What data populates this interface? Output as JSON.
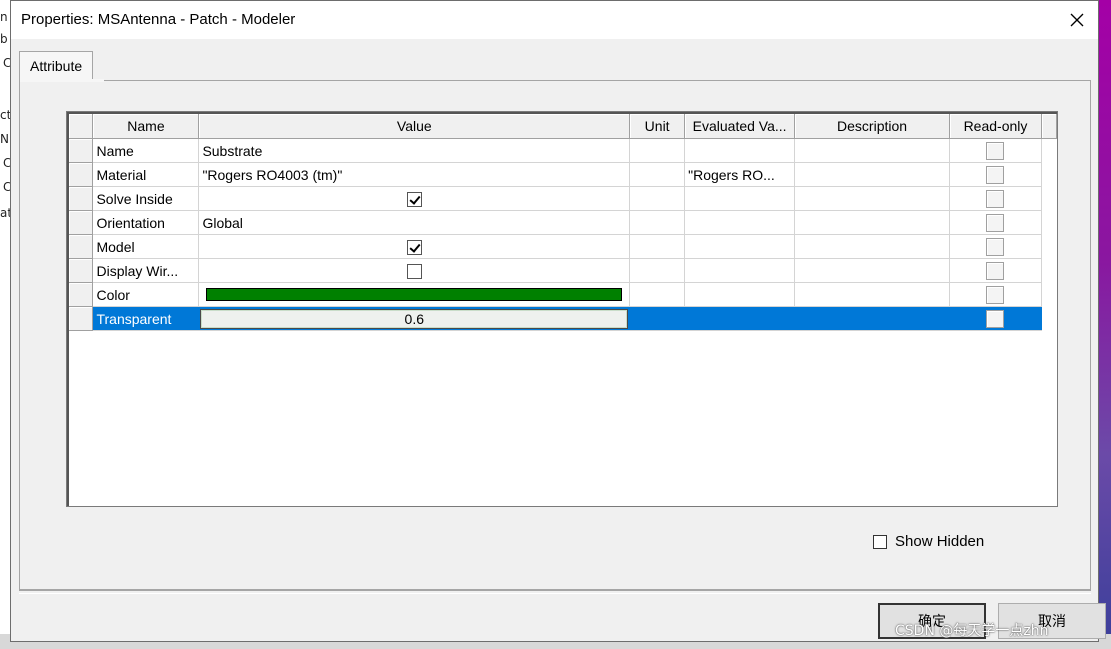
{
  "window": {
    "title": "Properties: MSAntenna - Patch - Modeler"
  },
  "tabs": [
    {
      "label": "Attribute",
      "active": true
    }
  ],
  "grid": {
    "columns": [
      "Name",
      "Value",
      "Unit",
      "Evaluated Va...",
      "Description",
      "Read-only"
    ],
    "rows": [
      {
        "name": "Name",
        "value": "Substrate",
        "value_type": "text",
        "unit": "",
        "evaluated": "",
        "description": "",
        "read_only": false
      },
      {
        "name": "Material",
        "value": "\"Rogers RO4003 (tm)\"",
        "value_type": "text",
        "unit": "",
        "evaluated": "\"Rogers RO...",
        "description": "",
        "read_only": false
      },
      {
        "name": "Solve Inside",
        "value_type": "checkbox",
        "checked": true,
        "unit": "",
        "evaluated": "",
        "description": "",
        "read_only": false
      },
      {
        "name": "Orientation",
        "value": "Global",
        "value_type": "text",
        "unit": "",
        "evaluated": "",
        "description": "",
        "read_only": false
      },
      {
        "name": "Model",
        "value_type": "checkbox",
        "checked": true,
        "unit": "",
        "evaluated": "",
        "description": "",
        "read_only": false
      },
      {
        "name": "Display Wir...",
        "value_type": "checkbox",
        "checked": false,
        "unit": "",
        "evaluated": "",
        "description": "",
        "read_only": false
      },
      {
        "name": "Color",
        "value_type": "color",
        "color": "#008000",
        "unit": "",
        "evaluated": "",
        "description": "",
        "read_only": false
      },
      {
        "name": "Transparent",
        "value": "0.6",
        "value_type": "edit",
        "unit": "",
        "evaluated": "",
        "description": "",
        "read_only": false,
        "selected": true
      }
    ]
  },
  "options": {
    "show_hidden_label": "Show Hidden",
    "show_hidden_checked": false
  },
  "buttons": {
    "ok_label": "确定",
    "cancel_label": "取消"
  },
  "watermark": "CSDN @每天学一点zhn",
  "background": {
    "left_fragments": [
      "n",
      "b",
      "C",
      "ct",
      "N",
      "C",
      "C",
      "at"
    ]
  },
  "colors": {
    "selection": "#0078d7",
    "color_swatch": "#008000"
  }
}
